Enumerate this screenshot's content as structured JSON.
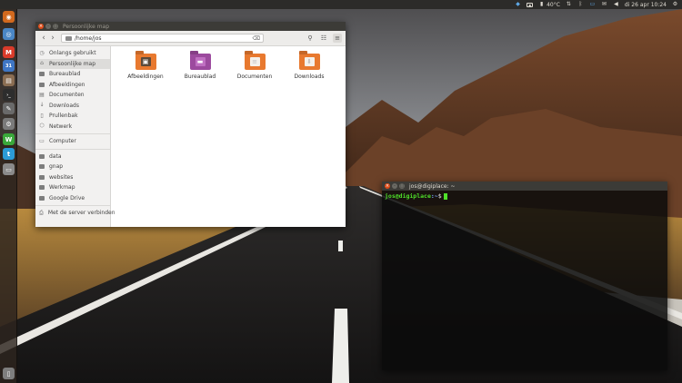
{
  "top_panel": {
    "temperature": "40°C",
    "datetime": "di 26 apr 10:24",
    "indicators": [
      "dropbox-icon",
      "box-icon",
      "temp-icon",
      "network-icon",
      "bluetooth-icon",
      "keyboard-icon",
      "mail-icon",
      "volume-icon",
      "settings-icon"
    ]
  },
  "launcher": {
    "items": [
      {
        "name": "ubuntu-dash-icon",
        "color": "#d2691e",
        "glyph": "◉"
      },
      {
        "name": "chrome-icon",
        "color": "#4a86c5",
        "glyph": "◎"
      },
      {
        "name": "gmail-icon",
        "color": "#d93b2a",
        "glyph": "M"
      },
      {
        "name": "calendar-icon",
        "color": "#3f76c4",
        "glyph": "31"
      },
      {
        "name": "files-icon",
        "color": "#8a6d52",
        "glyph": "▤"
      },
      {
        "name": "terminal-icon",
        "color": "#2d2d2d",
        "glyph": "›_"
      },
      {
        "name": "text-editor-icon",
        "color": "#6a6a6a",
        "glyph": "✎"
      },
      {
        "name": "gear-icon",
        "color": "#7a7a7a",
        "glyph": "⚙"
      },
      {
        "name": "wps-writer-icon",
        "color": "#3aa83a",
        "glyph": "W"
      },
      {
        "name": "twitter-icon",
        "color": "#2b9bd6",
        "glyph": "t"
      },
      {
        "name": "drive-icon",
        "color": "#8a8a8a",
        "glyph": "▭"
      },
      {
        "name": "trash-icon",
        "color": "#7e7e7e",
        "glyph": "▯"
      }
    ]
  },
  "file_manager": {
    "title": "Persoonlijke map",
    "path": "/home/jos",
    "sidebar": {
      "places": [
        {
          "label": "Onlangs gebruikt",
          "icon": "clock-icon",
          "glyph": "◷",
          "selected": false
        },
        {
          "label": "Persoonlijke map",
          "icon": "home-icon",
          "glyph": "⌂",
          "selected": true
        },
        {
          "label": "Bureaublad",
          "icon": "folder-icon",
          "glyph": "",
          "selected": false
        },
        {
          "label": "Afbeeldingen",
          "icon": "pictures-icon",
          "glyph": "",
          "selected": false
        },
        {
          "label": "Documenten",
          "icon": "document-icon",
          "glyph": "▤",
          "selected": false
        },
        {
          "label": "Downloads",
          "icon": "download-icon",
          "glyph": "↓",
          "selected": false
        },
        {
          "label": "Prullenbak",
          "icon": "trash-icon",
          "glyph": "▯",
          "selected": false
        },
        {
          "label": "Netwerk",
          "icon": "network-icon",
          "glyph": "⬡",
          "selected": false
        }
      ],
      "devices": [
        {
          "label": "Computer",
          "icon": "computer-icon",
          "glyph": "▭"
        }
      ],
      "bookmarks": [
        {
          "label": "data",
          "icon": "folder-icon"
        },
        {
          "label": "gnap",
          "icon": "folder-icon"
        },
        {
          "label": "websites",
          "icon": "folder-icon"
        },
        {
          "label": "Werkmap",
          "icon": "folder-icon"
        },
        {
          "label": "Google Drive",
          "icon": "folder-icon"
        }
      ],
      "connect": {
        "label": "Met de server verbinden",
        "icon": "server-icon",
        "glyph": "⎙"
      }
    },
    "items": [
      {
        "label": "Afbeeldingen",
        "color": "#e8792f",
        "emblem_color": "#5b4a3a",
        "glyph": "▣"
      },
      {
        "label": "Bureaublad",
        "color": "#9c4a9e",
        "emblem_color": "#c070c2",
        "glyph": "▬"
      },
      {
        "label": "Documenten",
        "color": "#e8792f",
        "emblem_color": "#f4f0ea",
        "glyph": "≡"
      },
      {
        "label": "Downloads",
        "color": "#e8792f",
        "emblem_color": "#f4f0ea",
        "glyph": "⬇"
      }
    ]
  },
  "terminal": {
    "title": "jos@digiplace: ~",
    "prompt_user": "jos@digiplace",
    "prompt_path": ":~",
    "prompt_symbol": "$"
  }
}
